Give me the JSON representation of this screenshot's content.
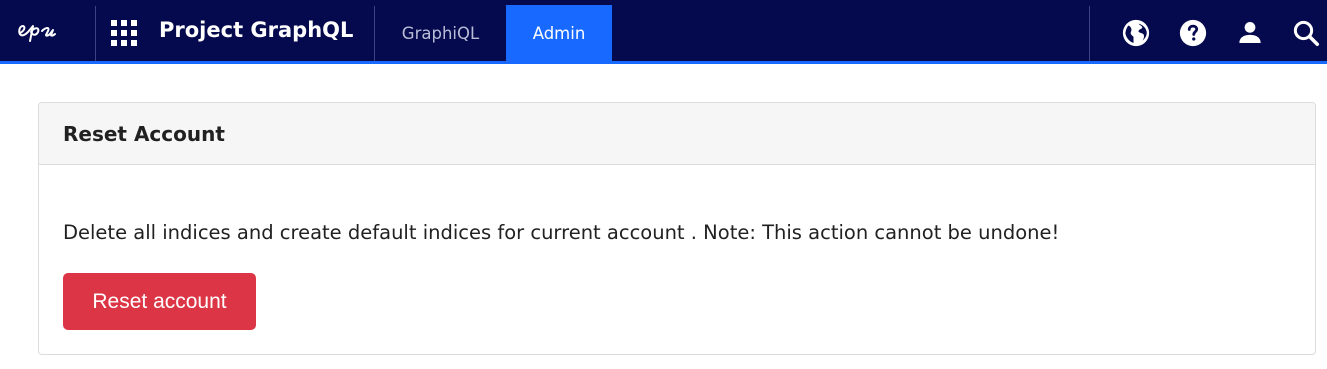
{
  "header": {
    "logo_icon": "episerver-logo",
    "apps_icon": "apps-grid-icon",
    "project_title": "Project GraphQL",
    "tabs": [
      {
        "label": "GraphiQL",
        "active": false
      },
      {
        "label": "Admin",
        "active": true
      }
    ],
    "right_icons": [
      "globe-icon",
      "help-icon",
      "user-icon",
      "search-icon"
    ],
    "background_color": "#050a4e",
    "accent_color": "#1769ff"
  },
  "card": {
    "title": "Reset Account",
    "description": "Delete all indices and create default indices for current account . Note: This action cannot be undone!",
    "button_label": "Reset account",
    "button_color": "#dc3545"
  }
}
